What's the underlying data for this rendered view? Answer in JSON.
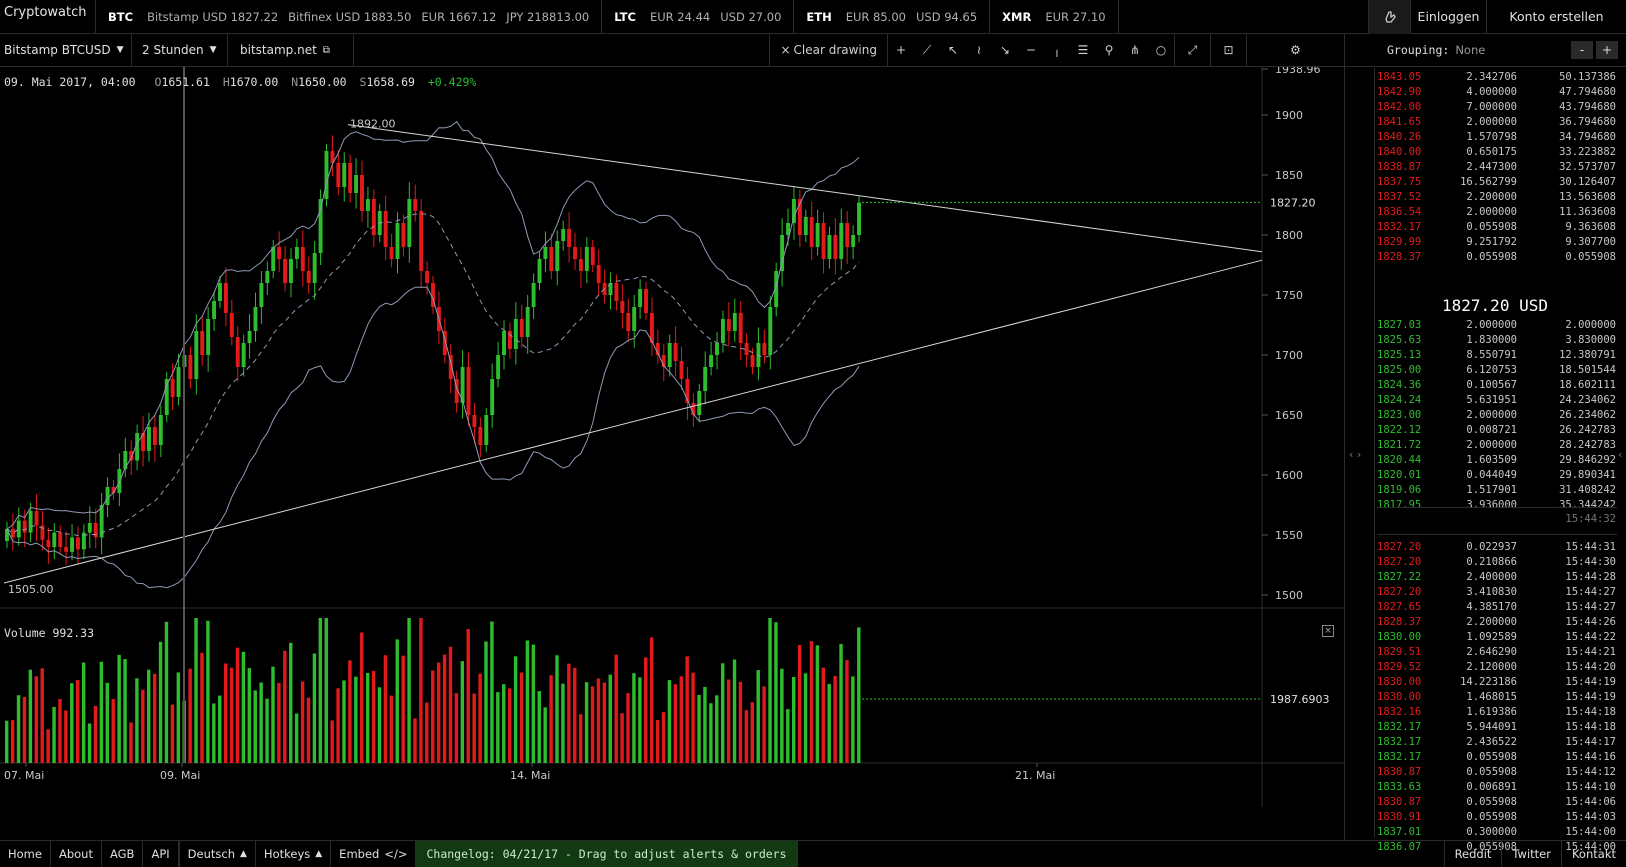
{
  "app": {
    "logo": "Cryptowatch"
  },
  "tickers": [
    {
      "sym": "BTC",
      "quotes": [
        "Bitstamp USD 1827.22",
        "Bitfinex USD 1883.50",
        "EUR 1667.12",
        "JPY 218813.00"
      ]
    },
    {
      "sym": "LTC",
      "quotes": [
        "EUR 24.44",
        "USD 27.00"
      ]
    },
    {
      "sym": "ETH",
      "quotes": [
        "EUR 85.00",
        "USD 94.65"
      ]
    },
    {
      "sym": "XMR",
      "quotes": [
        "EUR 27.10"
      ]
    }
  ],
  "auth": {
    "login": "Einloggen",
    "register": "Konto erstellen"
  },
  "toolbar": {
    "market": "Bitstamp BTCUSD",
    "period": "2 Stunden",
    "exchange_link": "bitstamp.net",
    "clear_drawing": "Clear drawing"
  },
  "colors": {
    "up": "#2ebd2e",
    "down": "#e31a1c",
    "bands": "#8e9ab5",
    "bg": "#000000"
  },
  "chart": {
    "ohlc_date": "09. Mai 2017, 04:00",
    "open": "1651.61",
    "high": "1670.00",
    "low": "1650.00",
    "close": "1658.69",
    "change": "+0.429%",
    "label_O": "O",
    "label_H": "H",
    "label_N": "N",
    "label_S": "S",
    "annotation_high": "1892.00",
    "annotation_low": "1505.00",
    "price_ticks": [
      "1938.96",
      "1900",
      "1850",
      "1800",
      "1750",
      "1700",
      "1650",
      "1600",
      "1550",
      "1500"
    ],
    "last_price": "1827.20",
    "volume_label": "Volume",
    "volume_value": "992.33",
    "volume_last": "1987.6903",
    "date_ticks": [
      "07. Mai",
      "09. Mai",
      "14. Mai",
      "21. Mai"
    ]
  },
  "chart_data": {
    "type": "candlestick",
    "y_range": [
      1490,
      1940
    ],
    "candles": [
      [
        1545,
        1555
      ],
      [
        1555,
        1548
      ],
      [
        1548,
        1562
      ],
      [
        1562,
        1552
      ],
      [
        1552,
        1570
      ],
      [
        1570,
        1558
      ],
      [
        1558,
        1546
      ],
      [
        1546,
        1540
      ],
      [
        1540,
        1552
      ],
      [
        1552,
        1540
      ],
      [
        1540,
        1536
      ],
      [
        1536,
        1548
      ],
      [
        1548,
        1538
      ],
      [
        1538,
        1552
      ],
      [
        1552,
        1560
      ],
      [
        1560,
        1548
      ],
      [
        1548,
        1575
      ],
      [
        1575,
        1590
      ],
      [
        1590,
        1585
      ],
      [
        1585,
        1605
      ],
      [
        1605,
        1620
      ],
      [
        1620,
        1612
      ],
      [
        1612,
        1635
      ],
      [
        1635,
        1620
      ],
      [
        1620,
        1640
      ],
      [
        1640,
        1625
      ],
      [
        1625,
        1650
      ],
      [
        1650,
        1680
      ],
      [
        1680,
        1665
      ],
      [
        1665,
        1690
      ],
      [
        1690,
        1700
      ],
      [
        1700,
        1680
      ],
      [
        1680,
        1720
      ],
      [
        1720,
        1700
      ],
      [
        1700,
        1730
      ],
      [
        1730,
        1745
      ],
      [
        1745,
        1760
      ],
      [
        1760,
        1735
      ],
      [
        1735,
        1715
      ],
      [
        1715,
        1690
      ],
      [
        1690,
        1710
      ],
      [
        1710,
        1720
      ],
      [
        1720,
        1740
      ],
      [
        1740,
        1760
      ],
      [
        1760,
        1770
      ],
      [
        1770,
        1790
      ],
      [
        1790,
        1780
      ],
      [
        1780,
        1760
      ],
      [
        1760,
        1780
      ],
      [
        1780,
        1790
      ],
      [
        1790,
        1770
      ],
      [
        1770,
        1760
      ],
      [
        1760,
        1785
      ],
      [
        1785,
        1830
      ],
      [
        1830,
        1870
      ],
      [
        1870,
        1860
      ],
      [
        1860,
        1840
      ],
      [
        1840,
        1860
      ],
      [
        1860,
        1835
      ],
      [
        1835,
        1850
      ],
      [
        1850,
        1820
      ],
      [
        1820,
        1830
      ],
      [
        1830,
        1800
      ],
      [
        1800,
        1820
      ],
      [
        1820,
        1790
      ],
      [
        1790,
        1780
      ],
      [
        1780,
        1810
      ],
      [
        1810,
        1790
      ],
      [
        1790,
        1830
      ],
      [
        1830,
        1820
      ],
      [
        1820,
        1770
      ],
      [
        1770,
        1760
      ],
      [
        1760,
        1740
      ],
      [
        1740,
        1720
      ],
      [
        1720,
        1700
      ],
      [
        1700,
        1680
      ],
      [
        1680,
        1660
      ],
      [
        1660,
        1690
      ],
      [
        1690,
        1650
      ],
      [
        1650,
        1640
      ],
      [
        1640,
        1625
      ],
      [
        1625,
        1650
      ],
      [
        1650,
        1680
      ],
      [
        1680,
        1700
      ],
      [
        1700,
        1720
      ],
      [
        1720,
        1705
      ],
      [
        1705,
        1730
      ],
      [
        1730,
        1715
      ],
      [
        1715,
        1740
      ],
      [
        1740,
        1760
      ],
      [
        1760,
        1780
      ],
      [
        1780,
        1790
      ],
      [
        1790,
        1770
      ],
      [
        1770,
        1795
      ],
      [
        1795,
        1805
      ],
      [
        1805,
        1790
      ],
      [
        1790,
        1780
      ],
      [
        1780,
        1770
      ],
      [
        1770,
        1790
      ],
      [
        1790,
        1775
      ],
      [
        1775,
        1760
      ],
      [
        1760,
        1750
      ],
      [
        1750,
        1760
      ],
      [
        1760,
        1745
      ],
      [
        1745,
        1735
      ],
      [
        1735,
        1720
      ],
      [
        1720,
        1740
      ],
      [
        1740,
        1755
      ],
      [
        1755,
        1735
      ],
      [
        1735,
        1710
      ],
      [
        1710,
        1700
      ],
      [
        1700,
        1690
      ],
      [
        1690,
        1710
      ],
      [
        1710,
        1695
      ],
      [
        1695,
        1680
      ],
      [
        1680,
        1660
      ],
      [
        1660,
        1650
      ],
      [
        1650,
        1670
      ],
      [
        1670,
        1690
      ],
      [
        1690,
        1700
      ],
      [
        1700,
        1710
      ],
      [
        1710,
        1730
      ],
      [
        1730,
        1720
      ],
      [
        1720,
        1735
      ],
      [
        1735,
        1710
      ],
      [
        1710,
        1700
      ],
      [
        1700,
        1690
      ],
      [
        1690,
        1710
      ],
      [
        1710,
        1700
      ],
      [
        1700,
        1740
      ],
      [
        1740,
        1770
      ],
      [
        1770,
        1800
      ],
      [
        1800,
        1810
      ],
      [
        1810,
        1830
      ],
      [
        1830,
        1800
      ],
      [
        1800,
        1815
      ],
      [
        1815,
        1790
      ],
      [
        1790,
        1810
      ],
      [
        1810,
        1780
      ],
      [
        1780,
        1800
      ],
      [
        1800,
        1780
      ],
      [
        1780,
        1810
      ],
      [
        1810,
        1790
      ],
      [
        1790,
        1800
      ],
      [
        1800,
        1827
      ]
    ],
    "volume_max": 2400
  },
  "orderbook": {
    "grouping_label": "Grouping:",
    "grouping_value": "None",
    "asks": [
      [
        "1843.05",
        "2.342706",
        "50.137386"
      ],
      [
        "1842.90",
        "4.000000",
        "47.794680"
      ],
      [
        "1842.00",
        "7.000000",
        "43.794680"
      ],
      [
        "1841.65",
        "2.000000",
        "36.794680"
      ],
      [
        "1840.26",
        "1.570798",
        "34.794680"
      ],
      [
        "1840.00",
        "0.650175",
        "33.223882"
      ],
      [
        "1838.87",
        "2.447300",
        "32.573707"
      ],
      [
        "1837.75",
        "16.562799",
        "30.126407"
      ],
      [
        "1837.52",
        "2.200000",
        "13.563608"
      ],
      [
        "1836.54",
        "2.000000",
        "11.363608"
      ],
      [
        "1832.17",
        "0.055908",
        "9.363608"
      ],
      [
        "1829.99",
        "9.251792",
        "9.307700"
      ],
      [
        "1828.37",
        "0.055908",
        "0.055908"
      ]
    ],
    "mid_price": "1827.20 USD",
    "bids": [
      [
        "1827.03",
        "2.000000",
        "2.000000"
      ],
      [
        "1825.63",
        "1.830000",
        "3.830000"
      ],
      [
        "1825.13",
        "8.550791",
        "12.380791"
      ],
      [
        "1825.00",
        "6.120753",
        "18.501544"
      ],
      [
        "1824.36",
        "0.100567",
        "18.602111"
      ],
      [
        "1824.24",
        "5.631951",
        "24.234062"
      ],
      [
        "1823.00",
        "2.000000",
        "26.234062"
      ],
      [
        "1822.12",
        "0.008721",
        "26.242783"
      ],
      [
        "1821.72",
        "2.000000",
        "28.242783"
      ],
      [
        "1820.44",
        "1.603509",
        "29.846292"
      ],
      [
        "1820.01",
        "0.044049",
        "29.890341"
      ],
      [
        "1819.06",
        "1.517901",
        "31.408242"
      ],
      [
        "1817.95",
        "3.936000",
        "35.344242"
      ]
    ],
    "update_time": "15:44:32"
  },
  "trades": [
    [
      "1827.20",
      "0.022937",
      "15:44:31",
      "r"
    ],
    [
      "1827.20",
      "0.210866",
      "15:44:30",
      "r"
    ],
    [
      "1827.22",
      "2.400000",
      "15:44:28",
      "g"
    ],
    [
      "1827.20",
      "3.410830",
      "15:44:27",
      "r"
    ],
    [
      "1827.65",
      "4.385170",
      "15:44:27",
      "r"
    ],
    [
      "1828.37",
      "2.200000",
      "15:44:26",
      "r"
    ],
    [
      "1830.00",
      "1.092589",
      "15:44:22",
      "g"
    ],
    [
      "1829.51",
      "2.646290",
      "15:44:21",
      "r"
    ],
    [
      "1829.52",
      "2.120000",
      "15:44:20",
      "r"
    ],
    [
      "1830.00",
      "14.223186",
      "15:44:19",
      "r"
    ],
    [
      "1830.00",
      "1.468015",
      "15:44:19",
      "r"
    ],
    [
      "1832.16",
      "1.619386",
      "15:44:18",
      "r"
    ],
    [
      "1832.17",
      "5.944091",
      "15:44:18",
      "g"
    ],
    [
      "1832.17",
      "2.436522",
      "15:44:17",
      "g"
    ],
    [
      "1832.17",
      "0.055908",
      "15:44:16",
      "g"
    ],
    [
      "1830.87",
      "0.055908",
      "15:44:12",
      "r"
    ],
    [
      "1833.63",
      "0.006891",
      "15:44:10",
      "g"
    ],
    [
      "1830.87",
      "0.055908",
      "15:44:06",
      "r"
    ],
    [
      "1830.91",
      "0.055908",
      "15:44:03",
      "r"
    ],
    [
      "1837.01",
      "0.300000",
      "15:44:00",
      "g"
    ],
    [
      "1836.07",
      "0.055908",
      "15:44:00",
      "g"
    ]
  ],
  "footer": {
    "links": [
      "Home",
      "About",
      "AGB",
      "API"
    ],
    "language": "Deutsch",
    "hotkeys": "Hotkeys",
    "embed": "Embed",
    "changelog": "Changelog: 04/21/17 - Drag to adjust alerts & orders",
    "right_links": [
      "Reddit",
      "Twitter",
      "Kontakt"
    ]
  }
}
